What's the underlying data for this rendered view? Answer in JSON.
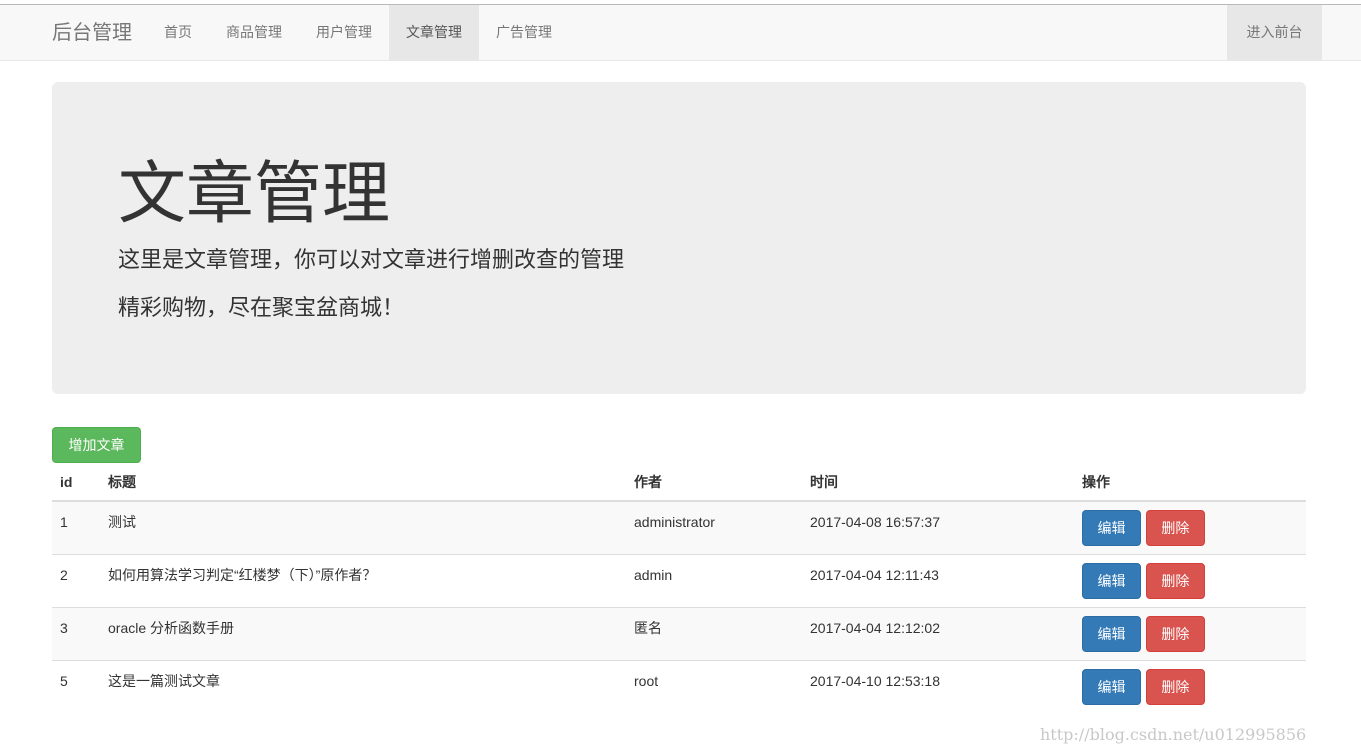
{
  "navbar": {
    "brand": "后台管理",
    "items": [
      {
        "label": "首页",
        "active": false
      },
      {
        "label": "商品管理",
        "active": false
      },
      {
        "label": "用户管理",
        "active": false
      },
      {
        "label": "文章管理",
        "active": true
      },
      {
        "label": "广告管理",
        "active": false
      }
    ],
    "right_link": "进入前台"
  },
  "jumbotron": {
    "title": "文章管理",
    "line1": "这里是文章管理，你可以对文章进行增删改查的管理",
    "line2": "精彩购物，尽在聚宝盆商城！"
  },
  "actions": {
    "add_label": "增加文章"
  },
  "table": {
    "headers": [
      "id",
      "标题",
      "作者",
      "时间",
      "操作"
    ],
    "edit_label": "编辑",
    "delete_label": "删除",
    "rows": [
      {
        "id": "1",
        "title": "测试",
        "author": "administrator",
        "time": "2017-04-08 16:57:37"
      },
      {
        "id": "2",
        "title": "如何用算法学习判定“红楼梦（下）”原作者？",
        "author": "admin",
        "time": "2017-04-04 12:11:43"
      },
      {
        "id": "3",
        "title": "oracle 分析函数手册",
        "author": "匿名",
        "time": "2017-04-04 12:12:02"
      },
      {
        "id": "5",
        "title": "这是一篇测试文章",
        "author": "root",
        "time": "2017-04-10 12:53:18"
      }
    ]
  },
  "watermark": "http://blog.csdn.net/u012995856",
  "colors": {
    "success": "#5cb85c",
    "primary": "#337ab7",
    "danger": "#d9534f",
    "jumbotron_bg": "#eeeeee",
    "navbar_bg": "#f8f8f8"
  }
}
